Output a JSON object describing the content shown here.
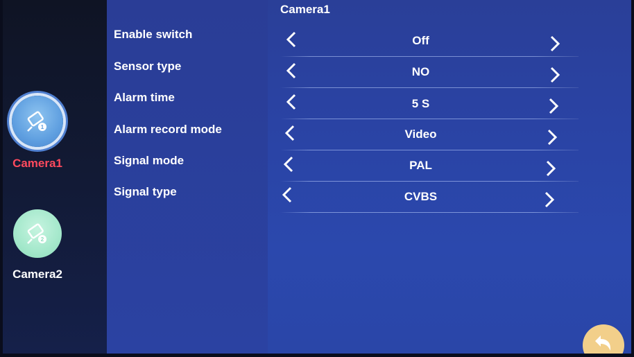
{
  "title": "Camera1",
  "sidebar": {
    "items": [
      {
        "label": "Camera1",
        "icon": "camera-icon",
        "active": true
      },
      {
        "label": "Camera2",
        "icon": "camera-icon",
        "active": false
      }
    ]
  },
  "settings": [
    {
      "label": "Enable switch",
      "value": "Off"
    },
    {
      "label": "Sensor type",
      "value": "NO"
    },
    {
      "label": "Alarm time",
      "value": "5 S"
    },
    {
      "label": "Alarm record mode",
      "value": "Video"
    },
    {
      "label": "Signal mode",
      "value": "PAL"
    },
    {
      "label": "Signal type",
      "value": "CVBS"
    }
  ],
  "icons": {
    "prev": "chevron-left-icon",
    "next": "chevron-right-icon",
    "back": "back-arrow-icon"
  },
  "colors": {
    "active_label": "#ff4a5e",
    "background": "#2b45a8",
    "back_button": "#f2cf8a"
  }
}
